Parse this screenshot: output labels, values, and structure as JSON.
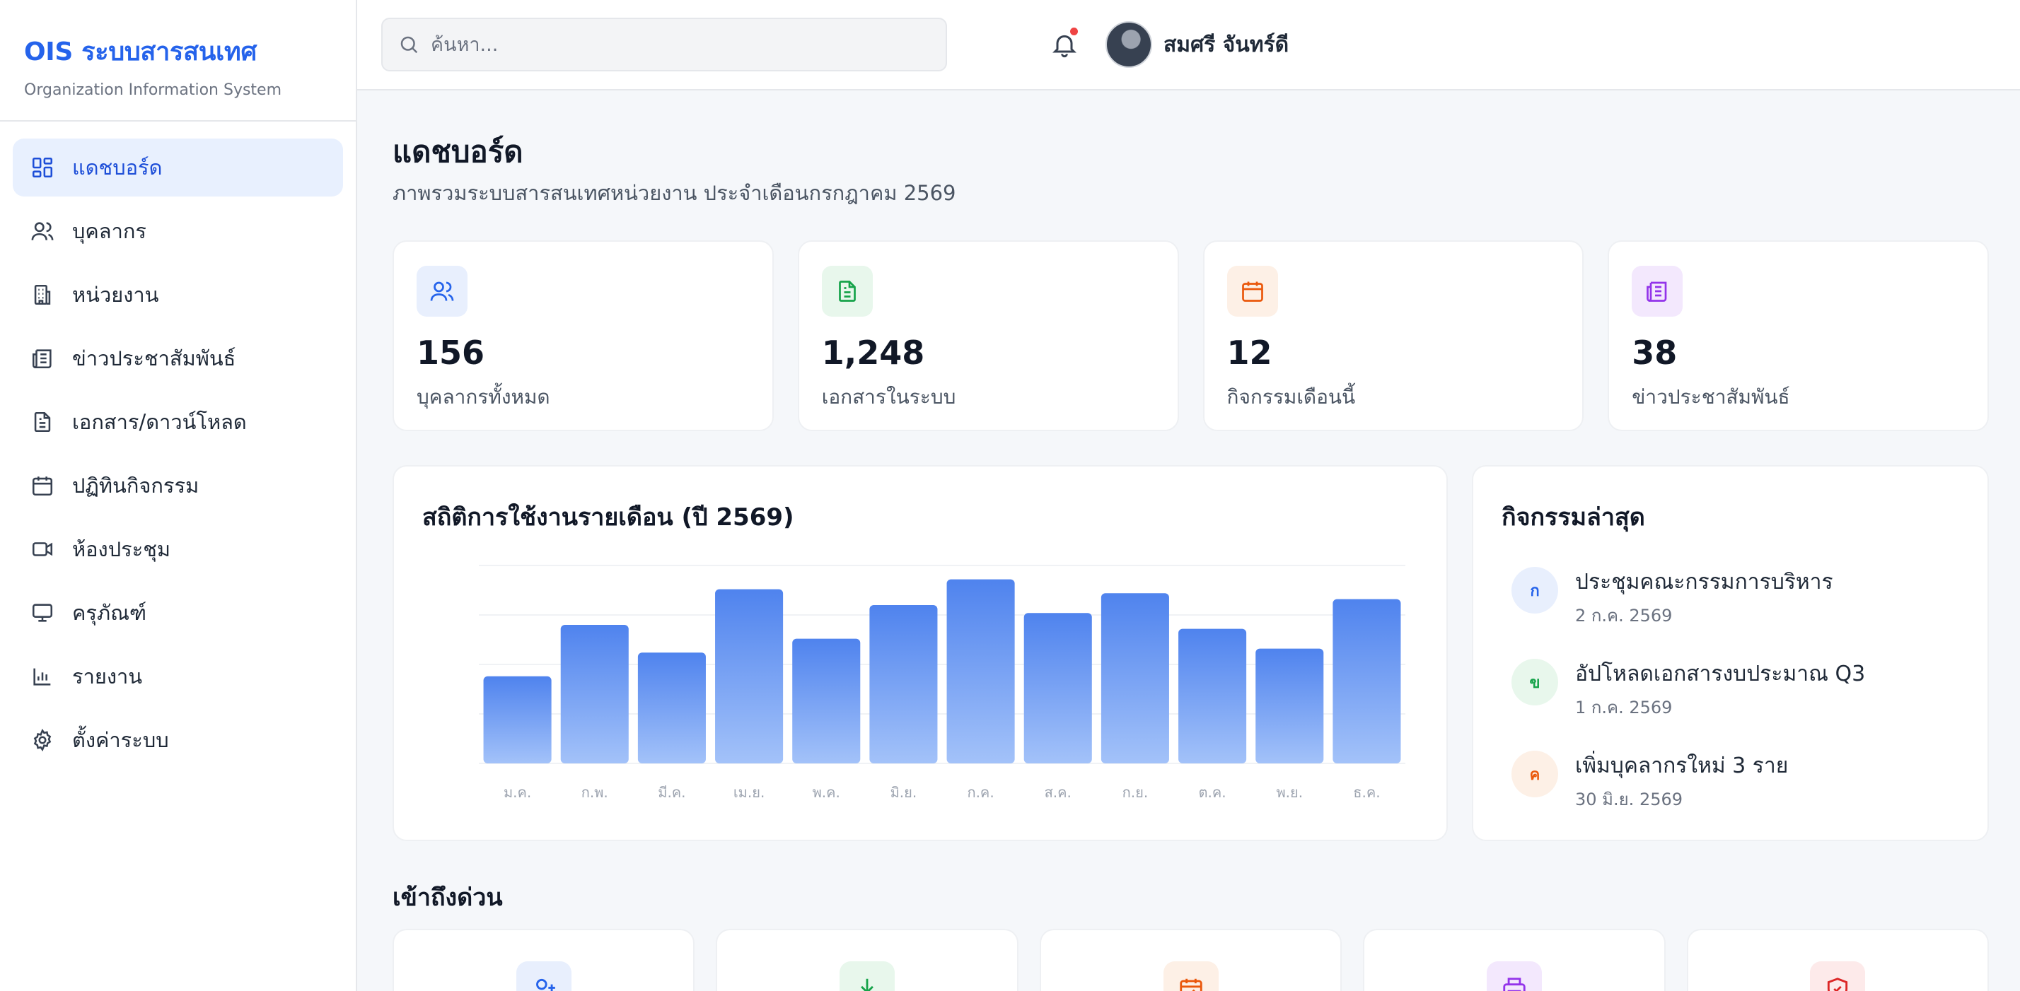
{
  "brand": {
    "title": "OIS ระบบสารสนเทศ",
    "subtitle": "Organization Information System"
  },
  "nav": [
    {
      "label": "แดชบอร์ด",
      "icon": "dashboard-icon",
      "active": true
    },
    {
      "label": "บุคลากร",
      "icon": "users-icon"
    },
    {
      "label": "หน่วยงาน",
      "icon": "building-icon"
    },
    {
      "label": "ข่าวประชาสัมพันธ์",
      "icon": "newspaper-icon"
    },
    {
      "label": "เอกสาร/ดาวน์โหลด",
      "icon": "document-icon"
    },
    {
      "label": "ปฏิทินกิจกรรม",
      "icon": "calendar-icon"
    },
    {
      "label": "ห้องประชุม",
      "icon": "video-icon"
    },
    {
      "label": "ครุภัณฑ์",
      "icon": "monitor-icon"
    },
    {
      "label": "รายงาน",
      "icon": "bar-chart-icon"
    },
    {
      "label": "ตั้งค่าระบบ",
      "icon": "gear-icon"
    }
  ],
  "topbar": {
    "search_placeholder": "ค้นหา...",
    "user_name": "สมศรี จันทร์ดี"
  },
  "page": {
    "title": "แดชบอร์ด",
    "subtitle": "ภาพรวมระบบสารสนเทศหน่วยงาน ประจำเดือนกรกฎาคม 2569"
  },
  "stats": [
    {
      "value": "156",
      "label": "บุคลากรทั้งหมด",
      "icon": "users-icon",
      "color": "#2563eb",
      "bg": "#e8effd"
    },
    {
      "value": "1,248",
      "label": "เอกสารในระบบ",
      "icon": "document-icon",
      "color": "#16a34a",
      "bg": "#e8f7ec"
    },
    {
      "value": "12",
      "label": "กิจกรรมเดือนนี้",
      "icon": "calendar-icon",
      "color": "#ea580c",
      "bg": "#fdf0e6"
    },
    {
      "value": "38",
      "label": "ข่าวประชาสัมพันธ์",
      "icon": "newspaper-icon",
      "color": "#9333ea",
      "bg": "#f3e8fd"
    }
  ],
  "chart_data": {
    "type": "bar",
    "title": "สถิติการใช้งานรายเดือน (ปี 2569)",
    "categories": [
      "ม.ค.",
      "ก.พ.",
      "มี.ค.",
      "เม.ย.",
      "พ.ค.",
      "มิ.ย.",
      "ก.ค.",
      "ส.ค.",
      "ก.ย.",
      "ต.ค.",
      "พ.ย.",
      "ธ.ค."
    ],
    "values": [
      44,
      70,
      56,
      88,
      63,
      80,
      93,
      76,
      86,
      68,
      58,
      83
    ],
    "ylim": [
      0,
      100
    ],
    "grid": true,
    "color": "#4f83ee"
  },
  "activities": {
    "title": "กิจกรรมล่าสุด",
    "items": [
      {
        "badge": "ก",
        "title": "ประชุมคณะกรรมการบริหาร",
        "date": "2 ก.ค. 2569",
        "color": "#2563eb",
        "bg": "#e8effd"
      },
      {
        "badge": "ข",
        "title": "อัปโหลดเอกสารงบประมาณ Q3",
        "date": "1 ก.ค. 2569",
        "color": "#16a34a",
        "bg": "#e8f7ec"
      },
      {
        "badge": "ค",
        "title": "เพิ่มบุคลากรใหม่ 3 ราย",
        "date": "30 มิ.ย. 2569",
        "color": "#ea580c",
        "bg": "#fdf0e6"
      }
    ]
  },
  "quick": {
    "title": "เข้าถึงด่วน",
    "items": [
      {
        "icon": "user-plus-icon",
        "color": "#2563eb",
        "bg": "#e8effd"
      },
      {
        "icon": "download-icon",
        "color": "#16a34a",
        "bg": "#e8f7ec"
      },
      {
        "icon": "calendar-check-icon",
        "color": "#ea580c",
        "bg": "#fdf0e6"
      },
      {
        "icon": "printer-icon",
        "color": "#9333ea",
        "bg": "#f3e8fd"
      },
      {
        "icon": "shield-icon",
        "color": "#dc2626",
        "bg": "#fdeaea"
      }
    ]
  }
}
